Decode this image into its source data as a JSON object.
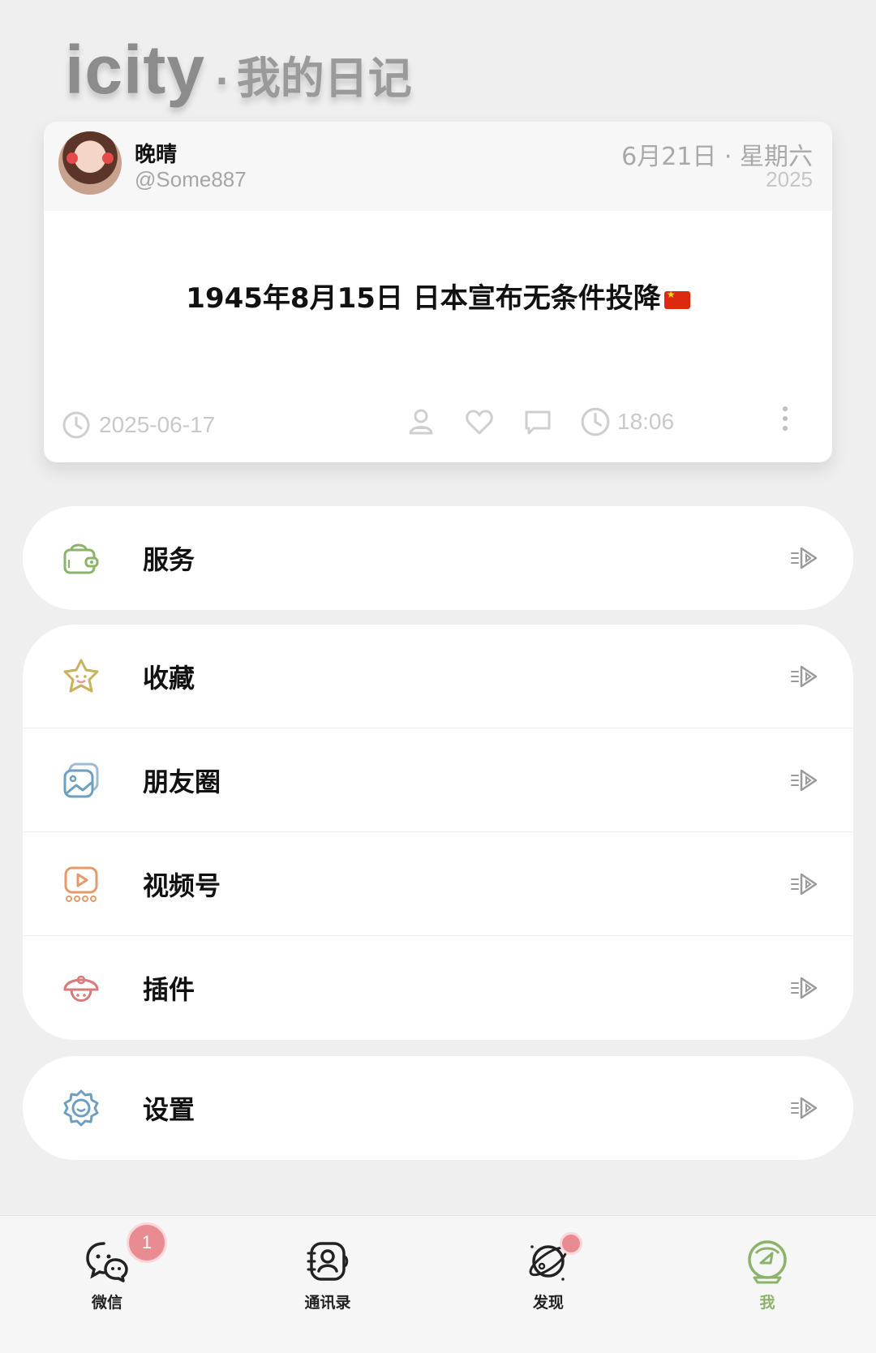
{
  "header": {
    "brand": "icity",
    "separator": "·",
    "subtitle": "我的日记"
  },
  "diary_card": {
    "user_name": "晚晴",
    "user_handle": "@Some887",
    "date_main": "6月21日 · 星期六",
    "date_year": "2025",
    "post_text": "1945年8月15日 日本宣布无条件投降",
    "flag_emoji": "china-flag",
    "footer_date": "2025-06-17",
    "footer_time": "18:06"
  },
  "menu": {
    "group1": [
      {
        "label": "服务",
        "icon": "wallet-icon",
        "color": "#8bb46a"
      }
    ],
    "group2": [
      {
        "label": "收藏",
        "icon": "star-icon",
        "color": "#c9b25a"
      },
      {
        "label": "朋友圈",
        "icon": "photos-icon",
        "color": "#6e9fbf"
      },
      {
        "label": "视频号",
        "icon": "video-icon",
        "color": "#e59a6b"
      },
      {
        "label": "插件",
        "icon": "mushroom-icon",
        "color": "#d97b7b"
      }
    ],
    "group3": [
      {
        "label": "设置",
        "icon": "gear-icon",
        "color": "#6e9fbf"
      }
    ]
  },
  "tabbar": {
    "tabs": [
      {
        "label": "微信",
        "badge": "1"
      },
      {
        "label": "通讯录"
      },
      {
        "label": "发现"
      },
      {
        "label": "我",
        "active": true
      }
    ]
  },
  "colors": {
    "accent_green": "#8bb46a",
    "badge_pink": "#e88c92",
    "muted_text": "#a9a9a9"
  }
}
